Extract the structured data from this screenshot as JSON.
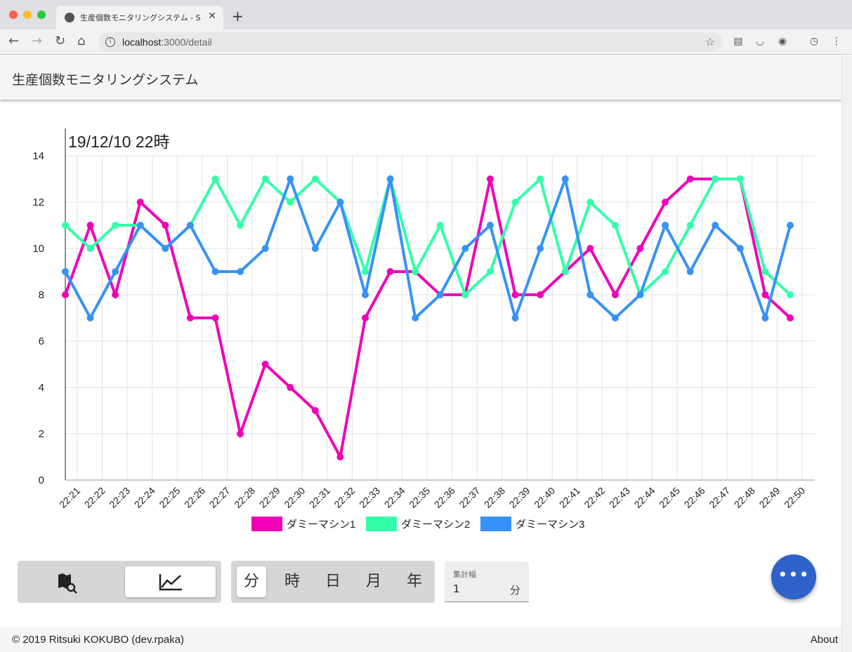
{
  "browser": {
    "tab_title": "生産個数モニタリングシステム - S",
    "tab_close": "✕",
    "new_tab": "+",
    "url_host": "localhost",
    "url_path": ":3000/detail"
  },
  "app": {
    "title": "生産個数モニタリングシステム"
  },
  "chart_data": {
    "type": "line",
    "title": "19/12/10 22時",
    "categories": [
      "22:21",
      "22:22",
      "22:23",
      "22:24",
      "22:25",
      "22:26",
      "22:27",
      "22:28",
      "22:29",
      "22:30",
      "22:31",
      "22:32",
      "22:33",
      "22:34",
      "22:35",
      "22:36",
      "22:37",
      "22:38",
      "22:39",
      "22:40",
      "22:41",
      "22:42",
      "22:43",
      "22:44",
      "22:45",
      "22:46",
      "22:47",
      "22:48",
      "22:49",
      "22:50"
    ],
    "ylim": [
      0,
      14
    ],
    "yticks": [
      0,
      2,
      4,
      6,
      8,
      10,
      12,
      14
    ],
    "grid": true,
    "legend_position": "bottom",
    "series": [
      {
        "name": "ダミーマシン1",
        "color": "#f000b8",
        "values": [
          8,
          11,
          8,
          12,
          11,
          7,
          7,
          2,
          5,
          4,
          3,
          1,
          7,
          9,
          9,
          8,
          8,
          13,
          8,
          8,
          9,
          10,
          8,
          10,
          12,
          13,
          13,
          13,
          8,
          7
        ]
      },
      {
        "name": "ダミーマシン2",
        "color": "#33ffa8",
        "values": [
          11,
          10,
          11,
          11,
          10,
          11,
          13,
          11,
          13,
          12,
          13,
          12,
          9,
          13,
          9,
          11,
          8,
          9,
          12,
          13,
          9,
          12,
          11,
          8,
          9,
          11,
          13,
          13,
          9,
          8
        ]
      },
      {
        "name": "ダミーマシン3",
        "color": "#3692f7",
        "values": [
          9,
          7,
          9,
          11,
          10,
          11,
          9,
          9,
          10,
          13,
          10,
          12,
          8,
          13,
          7,
          8,
          10,
          11,
          7,
          10,
          13,
          8,
          7,
          8,
          11,
          9,
          11,
          10,
          7,
          11
        ]
      }
    ]
  },
  "controls": {
    "units": [
      "分",
      "時",
      "日",
      "月",
      "年"
    ],
    "selected_unit": "分",
    "aggregation_label": "集計幅",
    "aggregation_value": "1",
    "aggregation_unit": "分",
    "fab_label": "•••"
  },
  "footer": {
    "copyright": "© 2019 Ritsuki KOKUBO (dev.rpaka)",
    "about": "About"
  }
}
